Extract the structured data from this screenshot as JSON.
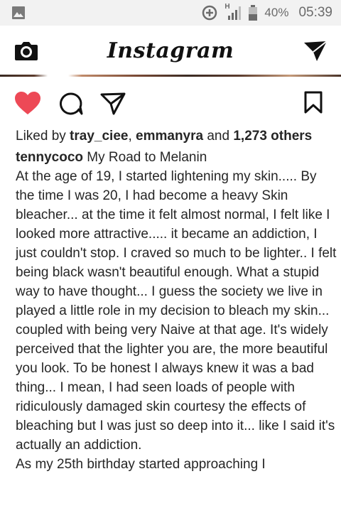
{
  "status_bar": {
    "battery_percent": "40%",
    "time": "05:39",
    "network": "H",
    "icons": [
      "gallery-icon",
      "data-saver-icon",
      "signal-icon",
      "battery-icon"
    ]
  },
  "header": {
    "logo_text": "Instagram",
    "icons": [
      "camera-icon",
      "direct-message-icon"
    ]
  },
  "post": {
    "actions": [
      "heart-icon",
      "comment-icon",
      "share-icon",
      "bookmark-icon"
    ],
    "liked": true,
    "likes_prefix": "Liked by ",
    "liker1": "tray_ciee",
    "sep": ", ",
    "liker2": "emmanyra",
    "and_text": " and ",
    "others": "1,273 others",
    "caption_user": "tennycoco",
    "caption_title": " My Road to Melanin",
    "caption_paragraph1": "At the age of 19, I started lightening my skin..... By the time I was 20, I had become a heavy Skin bleacher... at the time it felt almost normal, I felt like I looked more attractive..... it became an addiction, I just couldn't stop. I craved so much to be lighter.. I felt being black wasn't beautiful enough. What a stupid way to have thought... I guess the society we live in played a little role in my decision to bleach my skin... coupled with being very Naive at that age. It's widely  perceived that the lighter you are, the more beautiful you look. To be honest I always knew it was a bad thing... I mean, I had seen loads of people with ridiculously damaged skin courtesy the effects of bleaching but I was just so deep into it... like I said it's actually an addiction.",
    "caption_paragraph2": "As my 25th birthday started approaching I"
  },
  "colors": {
    "heart": "#ed4956",
    "text": "#262626",
    "status_bar_bg": "#f2f2f2"
  }
}
